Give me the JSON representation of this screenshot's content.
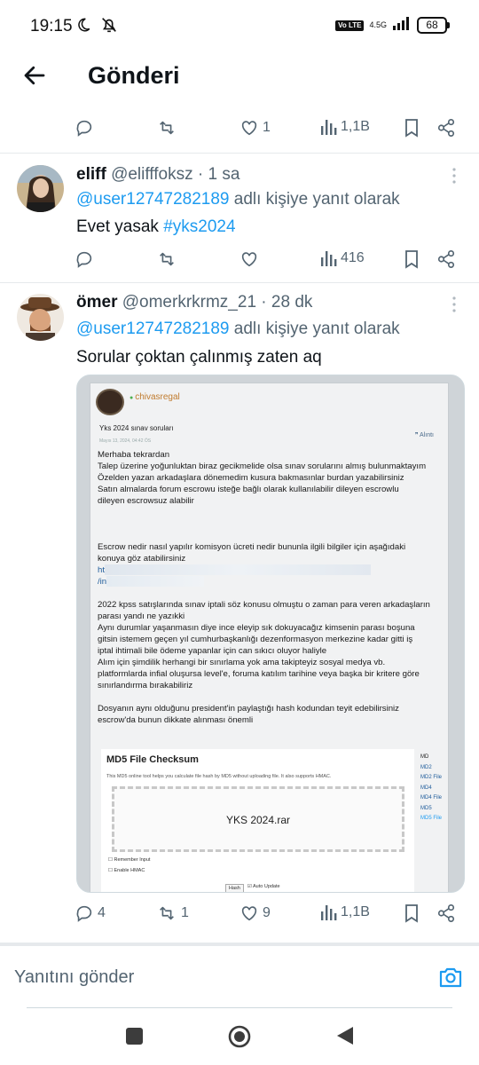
{
  "status_bar": {
    "time": "19:15",
    "volte": "Vo LTE",
    "network": "4.5G",
    "battery": "68"
  },
  "header": {
    "title": "Gönderi"
  },
  "top_actions": {
    "replies": "",
    "reposts": "",
    "likes": "1",
    "views": "1,1B"
  },
  "tweets": [
    {
      "name": "eliff",
      "handle": "@elifffoksz",
      "time": "1 sa",
      "reply_to": "@user12747282189",
      "reply_suffix": "adlı kişiye yanıt olarak",
      "text_plain": "Evet yasak ",
      "hashtag": "#yks2024",
      "actions": {
        "replies": "",
        "reposts": "",
        "likes": "",
        "views": "416"
      }
    },
    {
      "name": "ömer",
      "handle": "@omerkrkrmz_21",
      "time": "28 dk",
      "reply_to": "@user12747282189",
      "reply_suffix": "adlı kişiye yanıt olarak",
      "text": "Sorular çoktan çalınmış zaten aq",
      "actions": {
        "replies": "4",
        "reposts": "1",
        "likes": "9",
        "views": "1,1B"
      }
    }
  ],
  "media": {
    "username": "chivasregal",
    "subject": "Yks 2024 sınav soruları",
    "date": "Mayıs 13, 2024, 04:42 ÖS",
    "icons": "❞ Alıntı",
    "lines": [
      "Merhaba tekrardan",
      "Talep üzerine yoğunluktan biraz gecikmelide olsa sınav sorularını almış bulunmaktayım",
      "Özelden yazan arkadaşlara dönemedim kusura bakmasınlar burdan yazabilirsiniz",
      "Satın almalarda forum escrowu isteğe bağlı olarak kullanılabilir dileyen escrowlu",
      "dileyen escrowsuz alabilir",
      "",
      "",
      "Escrow nedir nasıl yapılır komisyon ücreti nedir bununla ilgili bilgiler için aşağıdaki",
      "konuya göz atabilirsiniz"
    ],
    "link1": "ht",
    "link2": "/in",
    "lines2": [
      "2022 kpss satışlarında sınav iptali söz konusu olmuştu o zaman para veren arkadaşların",
      "parası yandı ne yazıkki",
      "Aynı durumlar yaşanmasın diye ince eleyip sık dokuyacağız kimsenin parası boşuna",
      "gitsin istemem geçen yıl cumhurbaşkanlığı dezenformasyon merkezine kadar gitti iş",
      "iptal ihtimali bile ödeme yapanlar için can sıkıcı oluyor haliyle",
      "Alım için şimdilik herhangi bir sınırlama yok ama takipteyiz sosyal medya vb.",
      "platformlarda infial oluşursa level'e, foruma katılım tarihine veya başka bir kritere göre",
      "sınırlandırma bırakabiliriz",
      "",
      "Dosyanın aynı olduğunu president'in paylaştığı hash kodundan teyit edebilirsiniz",
      "escrow'da bunun dikkate alınması önemli"
    ],
    "md5": {
      "title": "MD5 File Checksum",
      "desc": "This MD5 online tool helps you calculate file hash by MD5 without uploading file. It also supports HMAC.",
      "file": "YKS 2024.rar",
      "opt1": "Remember Input",
      "opt2": "Enable HMAC",
      "btn1": "Hash",
      "btn2": "Auto Update",
      "side": [
        "MD",
        "MD2",
        "MD2 File",
        "MD4",
        "MD4 File",
        "MD5",
        "MD5 File"
      ]
    }
  },
  "composer": {
    "placeholder": "Yanıtını gönder"
  },
  "colors": {
    "accent": "#1d9bf0",
    "muted": "#536471"
  }
}
